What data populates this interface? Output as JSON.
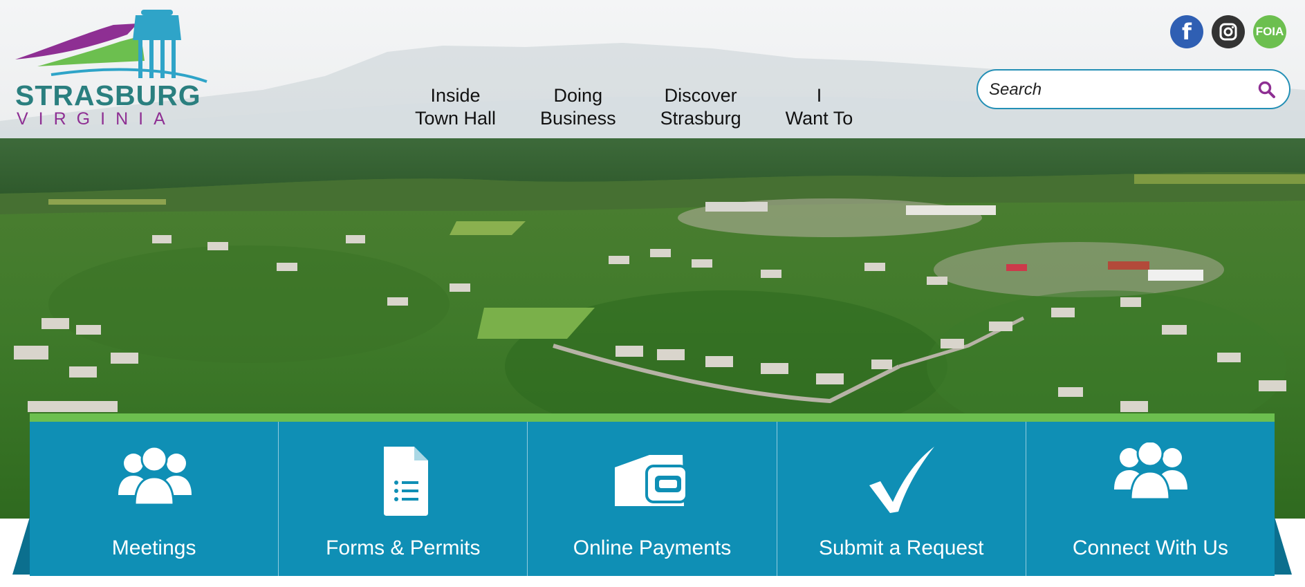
{
  "site": {
    "logo": {
      "line1": "STRASBURG",
      "line2": "VIRGINIA"
    }
  },
  "nav": {
    "items": [
      {
        "line1": "Inside",
        "line2": "Town Hall"
      },
      {
        "line1": "Doing",
        "line2": "Business"
      },
      {
        "line1": "Discover",
        "line2": "Strasburg"
      },
      {
        "line1": "I",
        "line2": "Want To"
      }
    ]
  },
  "social": {
    "facebook_glyph": "f",
    "foia_label": "FOIA"
  },
  "search": {
    "placeholder": "Search"
  },
  "quick_links": [
    {
      "label": "Meetings",
      "icon": "people-group-icon"
    },
    {
      "label": "Forms & Permits",
      "icon": "document-icon"
    },
    {
      "label": "Online Payments",
      "icon": "payment-card-icon"
    },
    {
      "label": "Submit a Request",
      "icon": "checkmark-icon"
    },
    {
      "label": "Connect With Us",
      "icon": "people-group-icon"
    }
  ],
  "colors": {
    "brand_blue": "#0f8fb5",
    "brand_green": "#6cbf4f",
    "brand_purple": "#8e2f93",
    "brand_teal": "#2a7f7f"
  }
}
